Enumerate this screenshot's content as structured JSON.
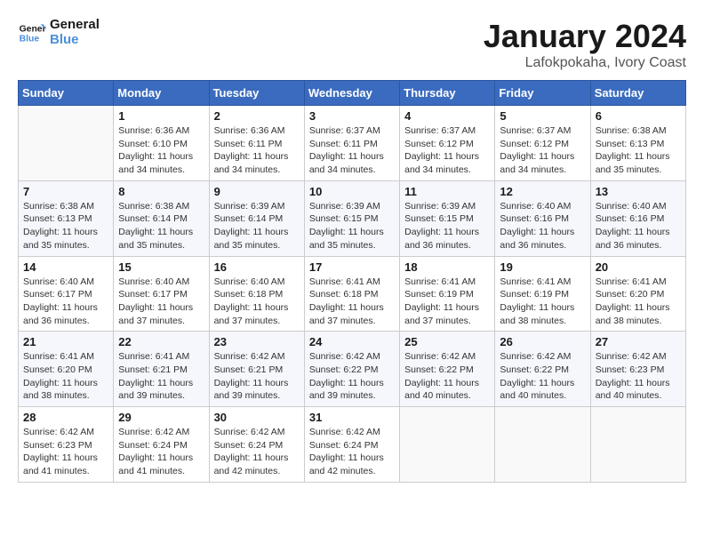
{
  "header": {
    "logo_line1": "General",
    "logo_line2": "Blue",
    "title": "January 2024",
    "subtitle": "Lafokpokaha, Ivory Coast"
  },
  "columns": [
    "Sunday",
    "Monday",
    "Tuesday",
    "Wednesday",
    "Thursday",
    "Friday",
    "Saturday"
  ],
  "weeks": [
    [
      {
        "day": "",
        "empty": true
      },
      {
        "day": "1",
        "sunrise": "6:36 AM",
        "sunset": "6:10 PM",
        "daylight": "11 hours and 34 minutes."
      },
      {
        "day": "2",
        "sunrise": "6:36 AM",
        "sunset": "6:11 PM",
        "daylight": "11 hours and 34 minutes."
      },
      {
        "day": "3",
        "sunrise": "6:37 AM",
        "sunset": "6:11 PM",
        "daylight": "11 hours and 34 minutes."
      },
      {
        "day": "4",
        "sunrise": "6:37 AM",
        "sunset": "6:12 PM",
        "daylight": "11 hours and 34 minutes."
      },
      {
        "day": "5",
        "sunrise": "6:37 AM",
        "sunset": "6:12 PM",
        "daylight": "11 hours and 34 minutes."
      },
      {
        "day": "6",
        "sunrise": "6:38 AM",
        "sunset": "6:13 PM",
        "daylight": "11 hours and 35 minutes."
      }
    ],
    [
      {
        "day": "7",
        "sunrise": "6:38 AM",
        "sunset": "6:13 PM",
        "daylight": "11 hours and 35 minutes."
      },
      {
        "day": "8",
        "sunrise": "6:38 AM",
        "sunset": "6:14 PM",
        "daylight": "11 hours and 35 minutes."
      },
      {
        "day": "9",
        "sunrise": "6:39 AM",
        "sunset": "6:14 PM",
        "daylight": "11 hours and 35 minutes."
      },
      {
        "day": "10",
        "sunrise": "6:39 AM",
        "sunset": "6:15 PM",
        "daylight": "11 hours and 35 minutes."
      },
      {
        "day": "11",
        "sunrise": "6:39 AM",
        "sunset": "6:15 PM",
        "daylight": "11 hours and 36 minutes."
      },
      {
        "day": "12",
        "sunrise": "6:40 AM",
        "sunset": "6:16 PM",
        "daylight": "11 hours and 36 minutes."
      },
      {
        "day": "13",
        "sunrise": "6:40 AM",
        "sunset": "6:16 PM",
        "daylight": "11 hours and 36 minutes."
      }
    ],
    [
      {
        "day": "14",
        "sunrise": "6:40 AM",
        "sunset": "6:17 PM",
        "daylight": "11 hours and 36 minutes."
      },
      {
        "day": "15",
        "sunrise": "6:40 AM",
        "sunset": "6:17 PM",
        "daylight": "11 hours and 37 minutes."
      },
      {
        "day": "16",
        "sunrise": "6:40 AM",
        "sunset": "6:18 PM",
        "daylight": "11 hours and 37 minutes."
      },
      {
        "day": "17",
        "sunrise": "6:41 AM",
        "sunset": "6:18 PM",
        "daylight": "11 hours and 37 minutes."
      },
      {
        "day": "18",
        "sunrise": "6:41 AM",
        "sunset": "6:19 PM",
        "daylight": "11 hours and 37 minutes."
      },
      {
        "day": "19",
        "sunrise": "6:41 AM",
        "sunset": "6:19 PM",
        "daylight": "11 hours and 38 minutes."
      },
      {
        "day": "20",
        "sunrise": "6:41 AM",
        "sunset": "6:20 PM",
        "daylight": "11 hours and 38 minutes."
      }
    ],
    [
      {
        "day": "21",
        "sunrise": "6:41 AM",
        "sunset": "6:20 PM",
        "daylight": "11 hours and 38 minutes."
      },
      {
        "day": "22",
        "sunrise": "6:41 AM",
        "sunset": "6:21 PM",
        "daylight": "11 hours and 39 minutes."
      },
      {
        "day": "23",
        "sunrise": "6:42 AM",
        "sunset": "6:21 PM",
        "daylight": "11 hours and 39 minutes."
      },
      {
        "day": "24",
        "sunrise": "6:42 AM",
        "sunset": "6:22 PM",
        "daylight": "11 hours and 39 minutes."
      },
      {
        "day": "25",
        "sunrise": "6:42 AM",
        "sunset": "6:22 PM",
        "daylight": "11 hours and 40 minutes."
      },
      {
        "day": "26",
        "sunrise": "6:42 AM",
        "sunset": "6:22 PM",
        "daylight": "11 hours and 40 minutes."
      },
      {
        "day": "27",
        "sunrise": "6:42 AM",
        "sunset": "6:23 PM",
        "daylight": "11 hours and 40 minutes."
      }
    ],
    [
      {
        "day": "28",
        "sunrise": "6:42 AM",
        "sunset": "6:23 PM",
        "daylight": "11 hours and 41 minutes."
      },
      {
        "day": "29",
        "sunrise": "6:42 AM",
        "sunset": "6:24 PM",
        "daylight": "11 hours and 41 minutes."
      },
      {
        "day": "30",
        "sunrise": "6:42 AM",
        "sunset": "6:24 PM",
        "daylight": "11 hours and 42 minutes."
      },
      {
        "day": "31",
        "sunrise": "6:42 AM",
        "sunset": "6:24 PM",
        "daylight": "11 hours and 42 minutes."
      },
      {
        "day": "",
        "empty": true
      },
      {
        "day": "",
        "empty": true
      },
      {
        "day": "",
        "empty": true
      }
    ]
  ],
  "labels": {
    "sunrise_prefix": "Sunrise: ",
    "sunset_prefix": "Sunset: ",
    "daylight_prefix": "Daylight: "
  }
}
